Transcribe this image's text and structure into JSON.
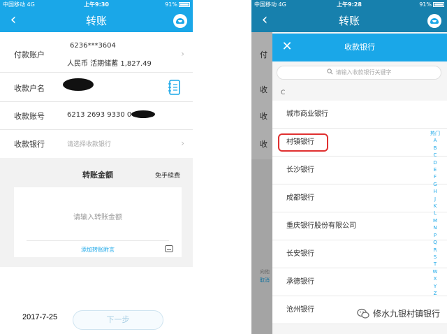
{
  "left": {
    "status": {
      "carrier": "中国移动 4G",
      "time": "上午9:30",
      "battery": "91%"
    },
    "nav": {
      "back_icon": "‹",
      "title": "转账"
    },
    "form": {
      "payer_label": "付款账户",
      "payer_account": "6236***3604",
      "payer_detail": "人民币 活期储蓄 1,827.49",
      "payee_name_label": "收款户名",
      "payee_account_label": "收款账号",
      "payee_account_value": "6213 2693 9330 04",
      "payee_bank_label": "收款银行",
      "payee_bank_placeholder": "请选择收款银行"
    },
    "amount": {
      "title": "转账金额",
      "fee_note": "免手续费",
      "placeholder": "请输入转账金额",
      "add_note": "添加转账附言"
    },
    "next_button": "下一步",
    "date": "2017-7-25"
  },
  "right": {
    "status": {
      "carrier": "中国移动 4G",
      "time": "上午9:28",
      "battery": "91%"
    },
    "nav": {
      "title": "转账"
    },
    "behind_labels": [
      "付",
      "收",
      "收",
      "收"
    ],
    "behind_bottom": [
      "向他",
      "取消"
    ],
    "picker": {
      "close_icon": "✕",
      "title": "收款银行",
      "search_placeholder": "请输入收款银行关键字",
      "section": "C",
      "banks": [
        "城市商业银行",
        "村镇银行",
        "长沙银行",
        "成都银行",
        "重庆银行股份有限公司",
        "长安银行",
        "承德银行",
        "沧州银行"
      ],
      "highlight_color": "#e03030",
      "index": [
        "热门",
        "A",
        "B",
        "C",
        "D",
        "E",
        "F",
        "G",
        "H",
        "J",
        "K",
        "L",
        "M",
        "N",
        "P",
        "Q",
        "R",
        "S",
        "T",
        "W",
        "X",
        "Y",
        "Z"
      ]
    }
  },
  "watermark": {
    "text": "修水九银村镇银行",
    "icon": "wechat-icon"
  }
}
